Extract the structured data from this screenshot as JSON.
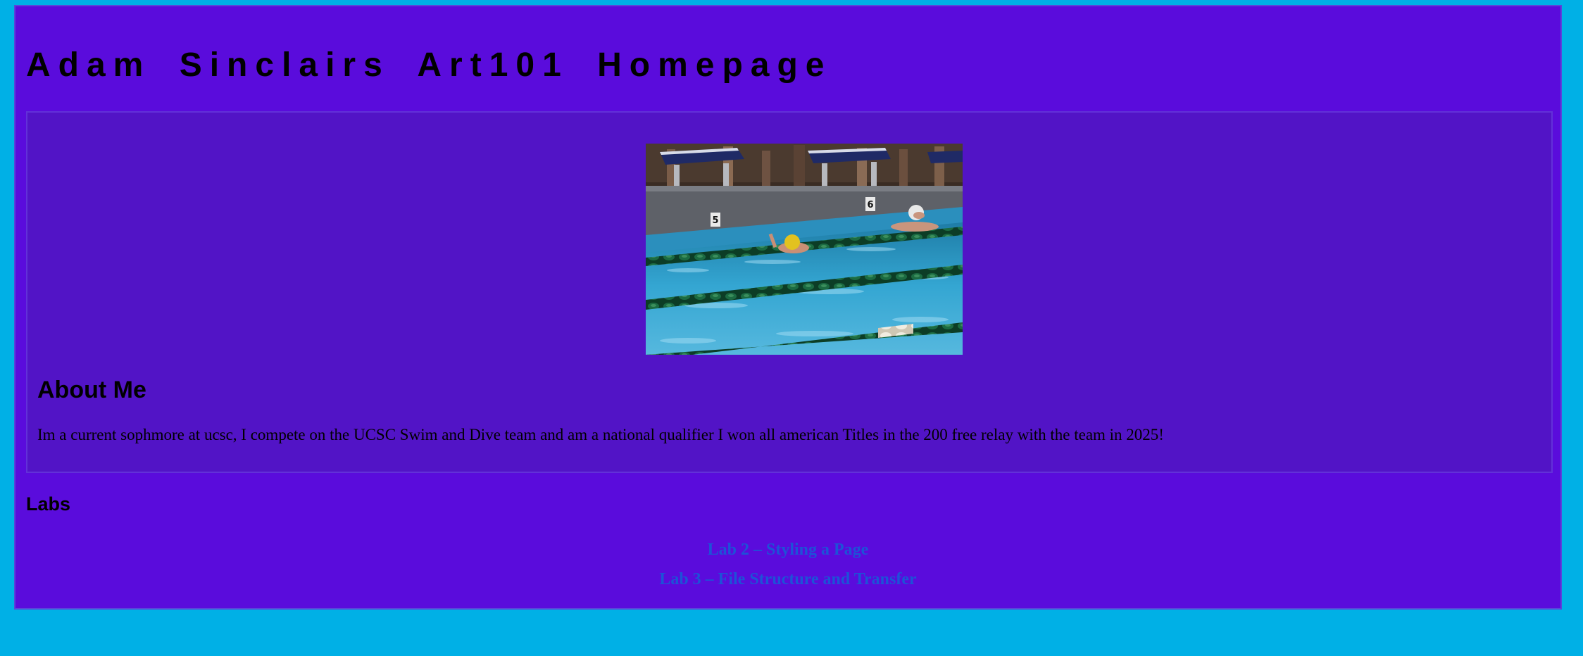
{
  "header": {
    "title": "Adam Sinclairs Art101 Homepage"
  },
  "about": {
    "photo_alt": "Swimmers racing in a pool lane",
    "heading": "About Me",
    "text": "Im a current sophmore at ucsc, I compete on the UCSC Swim and Dive team and am a national qualifier I won all american Titles in the 200 free relay with the team in 2025!"
  },
  "labs": {
    "heading": "Labs",
    "links": [
      {
        "label": "Lab 2 – Styling a Page"
      },
      {
        "label": "Lab 3 – File Structure and Transfer"
      }
    ]
  },
  "colors": {
    "page_background": "#00b0e6",
    "content_background": "#5a0cdc",
    "card_background": "#5214c6",
    "link_color": "#1d52d8",
    "text_color": "#000000"
  }
}
